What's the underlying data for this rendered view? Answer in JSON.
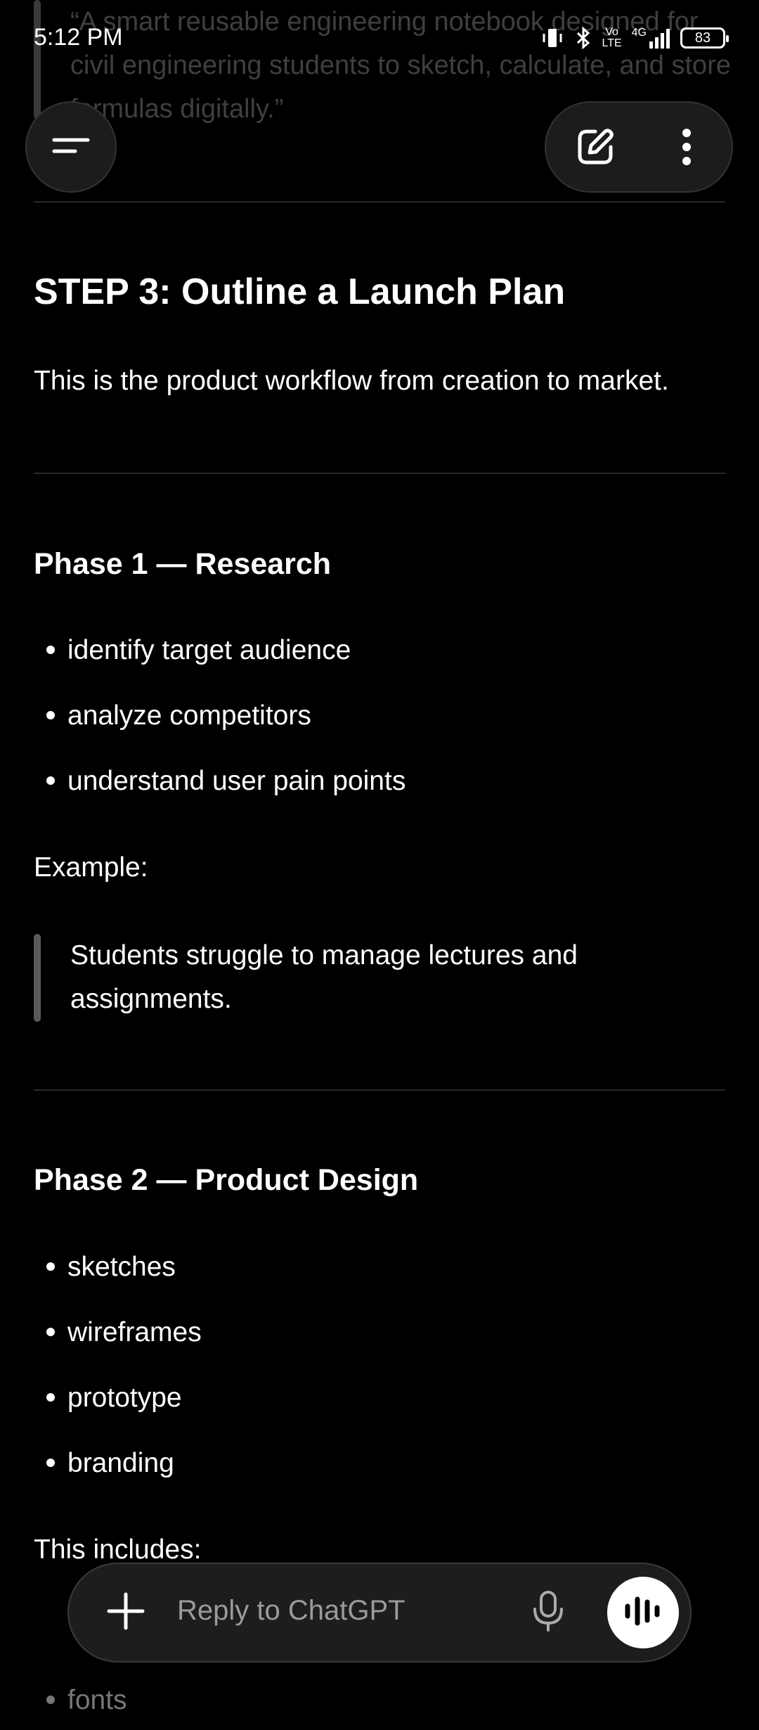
{
  "status_bar": {
    "time": "5:12 PM",
    "volte_top": "Vo",
    "volte_bottom": "LTE",
    "network": "4G",
    "battery": "83"
  },
  "top_quote": {
    "text": "“A smart reusable engineering notebook designed for civil engineering students to sketch, calculate, and store formulas digitally.”"
  },
  "header": {
    "menu_icon": "menu-icon",
    "edit_icon": "new-chat-icon",
    "more_icon": "more-vertical-icon"
  },
  "content": {
    "step_title": "STEP 3: Outline a Launch Plan",
    "step_intro": "This is the product workflow from creation to market.",
    "phase1": {
      "title": "Phase 1 — Research",
      "items": [
        "identify target audience",
        "analyze competitors",
        "understand user pain points"
      ],
      "example_label": "Example:",
      "example_quote": "Students struggle to manage lectures and assignments."
    },
    "phase2": {
      "title": "Phase 2 — Product Design",
      "items": [
        "sketches",
        "wireframes",
        "prototype",
        "branding"
      ],
      "includes_label": "This includes:",
      "includes_items": [
        "fonts"
      ]
    }
  },
  "composer": {
    "placeholder": "Reply to ChatGPT",
    "plus_icon": "plus-icon",
    "mic_icon": "microphone-icon",
    "voice_icon": "voice-mode-icon"
  }
}
